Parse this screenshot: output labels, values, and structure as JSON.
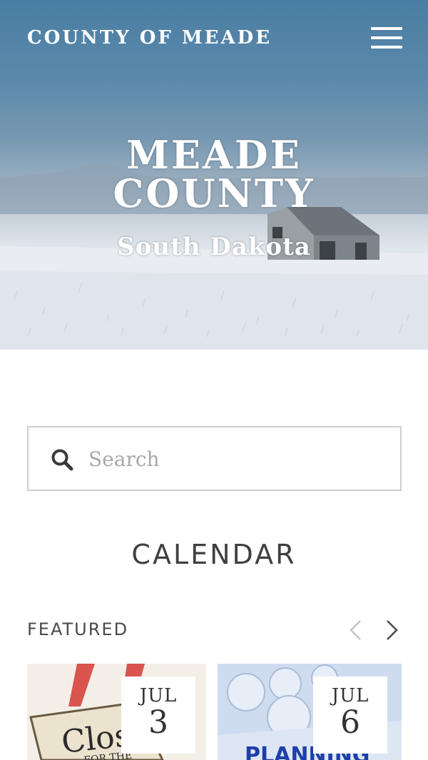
{
  "header": {
    "site_title": "COUNTY OF MEADE",
    "menu_icon": "hamburger-menu-icon"
  },
  "hero": {
    "title_line1": "MEADE",
    "title_line2": "COUNTY",
    "subtitle": "South Dakota"
  },
  "search": {
    "placeholder": "Search",
    "value": "",
    "icon": "search-icon"
  },
  "calendar": {
    "heading": "CALENDAR",
    "featured_label": "FEATURED",
    "prev_icon": "chevron-left-icon",
    "next_icon": "chevron-right-icon",
    "events": [
      {
        "month": "JUL",
        "day": "3",
        "image_text": "Clos",
        "image_subtext": "FOR THE"
      },
      {
        "month": "JUL",
        "day": "6",
        "image_text": "PLANNING"
      }
    ]
  },
  "colors": {
    "sky_top": "#4a7ea4",
    "snow": "#eef1f4",
    "border": "#cfcfcf",
    "text": "#3a3a3a",
    "placeholder": "#a8a8a8"
  }
}
